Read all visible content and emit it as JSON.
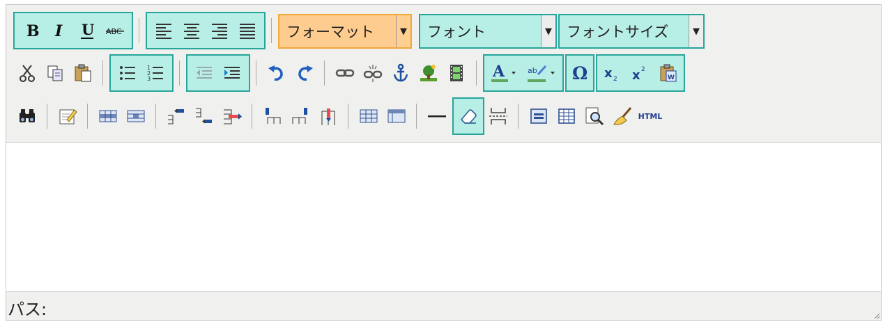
{
  "toolbar": {
    "row1": {
      "format_select": {
        "label": "フォーマット"
      },
      "font_select": {
        "label": "フォント"
      },
      "fontsize_select": {
        "label": "フォントサイズ"
      }
    },
    "row3": {
      "html_label": "HTML"
    }
  },
  "statusbar": {
    "path_label": "パス:"
  },
  "colors": {
    "highlight_border": "#27a59a",
    "highlight_fill": "#b7efe6",
    "format_fill": "#ffcc8f",
    "format_border": "#f1a83b"
  }
}
